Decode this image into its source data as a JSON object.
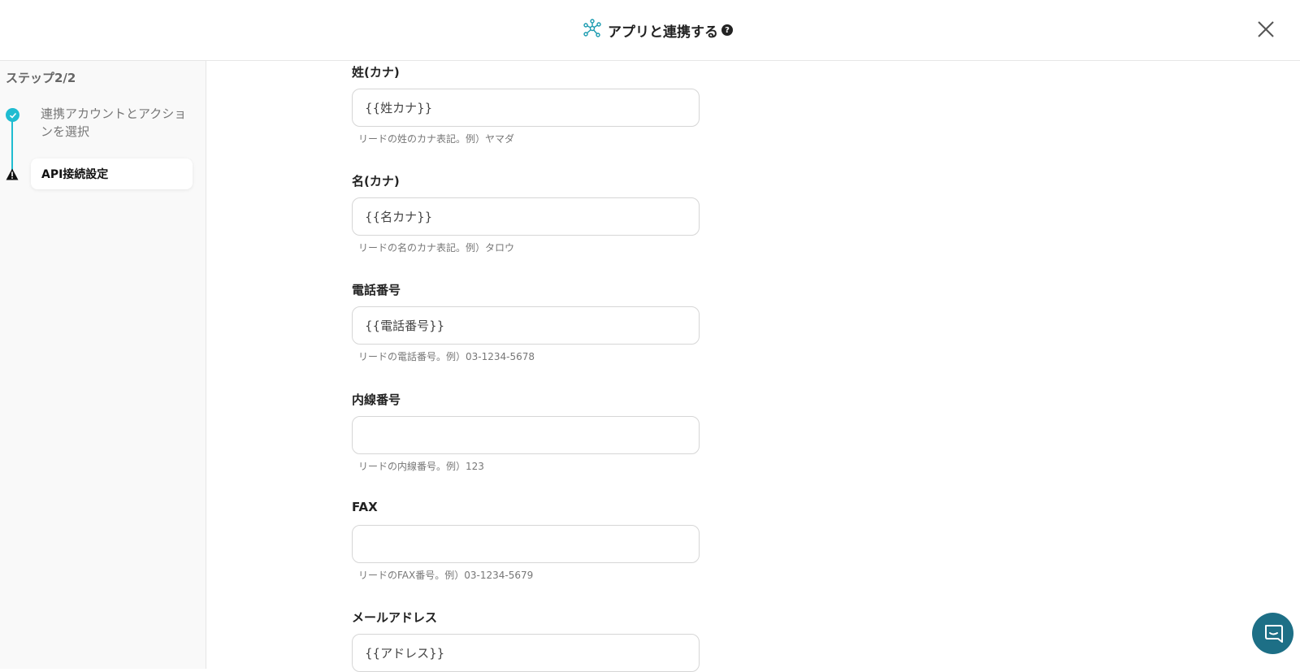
{
  "header": {
    "title": "アプリと連携する",
    "help": "?"
  },
  "sidebar": {
    "step_label": "ステップ2/2",
    "steps": [
      {
        "label": "連携アカウントとアクションを選択",
        "status": "complete"
      },
      {
        "label": "API接続設定",
        "status": "warning",
        "active": true
      }
    ]
  },
  "form": {
    "fields": [
      {
        "label": "姓(カナ)",
        "value": "{{姓カナ}}",
        "help": "リードの姓のカナ表記。例）ヤマダ"
      },
      {
        "label": "名(カナ)",
        "value": "{{名カナ}}",
        "help": "リードの名のカナ表記。例）タロウ"
      },
      {
        "label": "電話番号",
        "value": "{{電話番号}}",
        "help": "リードの電話番号。例）03-1234-5678"
      },
      {
        "label": "内線番号",
        "value": "",
        "help": "リードの内線番号。例）123"
      },
      {
        "label": "FAX",
        "value": "",
        "help": "リードのFAX番号。例）03-1234-5679"
      },
      {
        "label": "メールアドレス",
        "value": "{{アドレス}}",
        "help": ""
      }
    ]
  },
  "colors": {
    "accent": "#1fbcd1",
    "chat": "#1d6f86",
    "network_icon": "#1a9bb0"
  },
  "icons": {
    "header": "network-icon",
    "close": "close-icon",
    "step_done": "check-circle-icon",
    "step_warning": "warning-icon",
    "chat": "chat-bubble-icon"
  }
}
